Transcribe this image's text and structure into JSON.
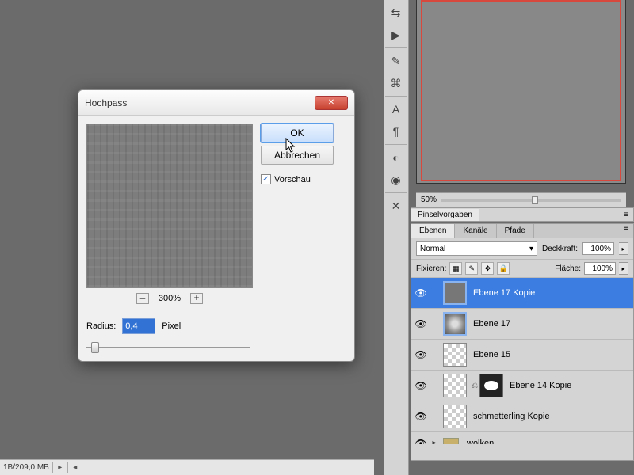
{
  "dialog": {
    "title": "Hochpass",
    "ok": "OK",
    "cancel": "Abbrechen",
    "preview_label": "Vorschau",
    "preview_checked": true,
    "zoom_minus": "–",
    "zoom_pct": "300%",
    "zoom_plus": "+",
    "radius_label": "Radius:",
    "radius_value": "0,4",
    "radius_unit": "Pixel"
  },
  "statusbar": {
    "mem": "1B/209,0 MB"
  },
  "canvas_zoom": {
    "pct": "50%"
  },
  "panels": {
    "pinsel": "Pinselvorgaben"
  },
  "layers": {
    "tabs": {
      "ebenen": "Ebenen",
      "kanale": "Kanäle",
      "pfade": "Pfade"
    },
    "blend_mode": "Normal",
    "deckkraft_label": "Deckkraft:",
    "deckkraft_value": "100%",
    "fixieren_label": "Fixieren:",
    "flache_label": "Fläche:",
    "flache_value": "100%",
    "items": [
      {
        "name": "Ebene 17 Kopie",
        "selected": true
      },
      {
        "name": "Ebene 17"
      },
      {
        "name": "Ebene 15"
      },
      {
        "name": "Ebene 14 Kopie",
        "has_mask": true
      },
      {
        "name": "schmetterling Kopie"
      },
      {
        "name": "wolken",
        "group": true
      }
    ]
  }
}
